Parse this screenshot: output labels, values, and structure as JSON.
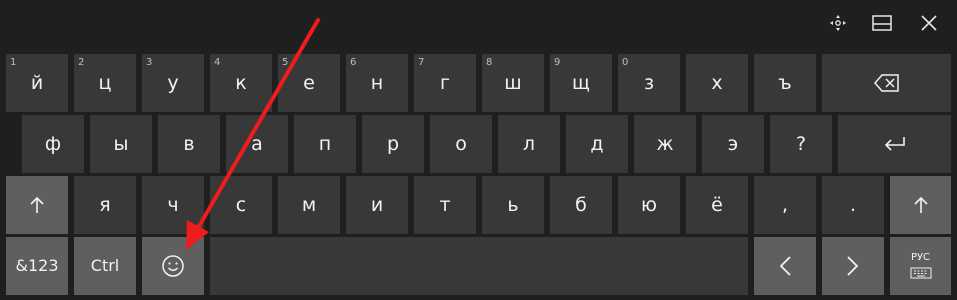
{
  "topbar": {
    "icons": [
      "dock-move-icon",
      "dock-keyboard-icon",
      "close-icon"
    ]
  },
  "row1": [
    {
      "num": "1",
      "label": "й"
    },
    {
      "num": "2",
      "label": "ц"
    },
    {
      "num": "3",
      "label": "у"
    },
    {
      "num": "4",
      "label": "к"
    },
    {
      "num": "5",
      "label": "е"
    },
    {
      "num": "6",
      "label": "н"
    },
    {
      "num": "7",
      "label": "г"
    },
    {
      "num": "8",
      "label": "ш"
    },
    {
      "num": "9",
      "label": "щ"
    },
    {
      "num": "0",
      "label": "з"
    },
    {
      "num": "",
      "label": "х"
    },
    {
      "num": "",
      "label": "ъ"
    }
  ],
  "row2": [
    "ф",
    "ы",
    "в",
    "а",
    "п",
    "р",
    "о",
    "л",
    "д",
    "ж",
    "э",
    "?"
  ],
  "row3": [
    "я",
    "ч",
    "с",
    "м",
    "и",
    "т",
    "ь",
    "б",
    "ю",
    "ё",
    ",",
    "."
  ],
  "row4": {
    "symbols_label": "&123",
    "ctrl_label": "Ctrl",
    "language_label": "РУС"
  },
  "colors": {
    "background": "#1f1f1f",
    "key": "#383838",
    "key_special": "#5f5f5f",
    "annotation_arrow": "#ee1c1c"
  }
}
